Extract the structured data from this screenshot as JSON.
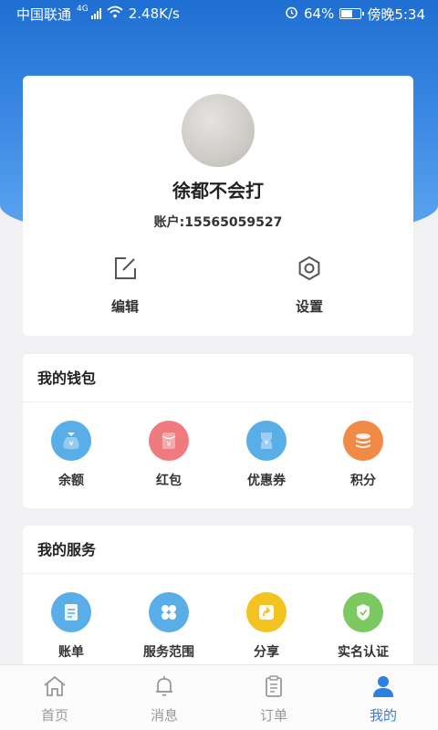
{
  "status_bar": {
    "carrier": "中国联通",
    "network": "4G",
    "speed": "2.48K/s",
    "battery": "64%",
    "battery_level": 0.64,
    "time": "傍晚5:34"
  },
  "profile": {
    "name": "徐都不会打",
    "account": "账户:15565059527",
    "actions": [
      {
        "label": "编辑",
        "icon": "edit-icon"
      },
      {
        "label": "设置",
        "icon": "settings-icon"
      }
    ]
  },
  "wallet": {
    "title": "我的钱包",
    "items": [
      {
        "label": "余额",
        "icon": "money-bag-icon",
        "color": "#5aaee8"
      },
      {
        "label": "红包",
        "icon": "red-envelope-icon",
        "color": "#ef7b7f"
      },
      {
        "label": "优惠券",
        "icon": "coupon-icon",
        "color": "#5aaee8"
      },
      {
        "label": "积分",
        "icon": "coins-icon",
        "color": "#f08a46"
      }
    ]
  },
  "services": {
    "title": "我的服务",
    "items": [
      {
        "label": "账单",
        "icon": "bill-icon",
        "color": "#5aaee8"
      },
      {
        "label": "服务范围",
        "icon": "grid-icon",
        "color": "#5aaee8"
      },
      {
        "label": "分享",
        "icon": "share-icon",
        "color": "#f3c322"
      },
      {
        "label": "实名认证",
        "icon": "shield-check-icon",
        "color": "#7cc961"
      }
    ]
  },
  "tabbar": {
    "tabs": [
      {
        "label": "首页",
        "icon": "home-icon",
        "active": false
      },
      {
        "label": "消息",
        "icon": "bell-icon",
        "active": false
      },
      {
        "label": "订单",
        "icon": "clipboard-icon",
        "active": false
      },
      {
        "label": "我的",
        "icon": "user-icon",
        "active": true
      }
    ],
    "active_color": "#2f7fe0",
    "inactive_color": "#999999"
  }
}
